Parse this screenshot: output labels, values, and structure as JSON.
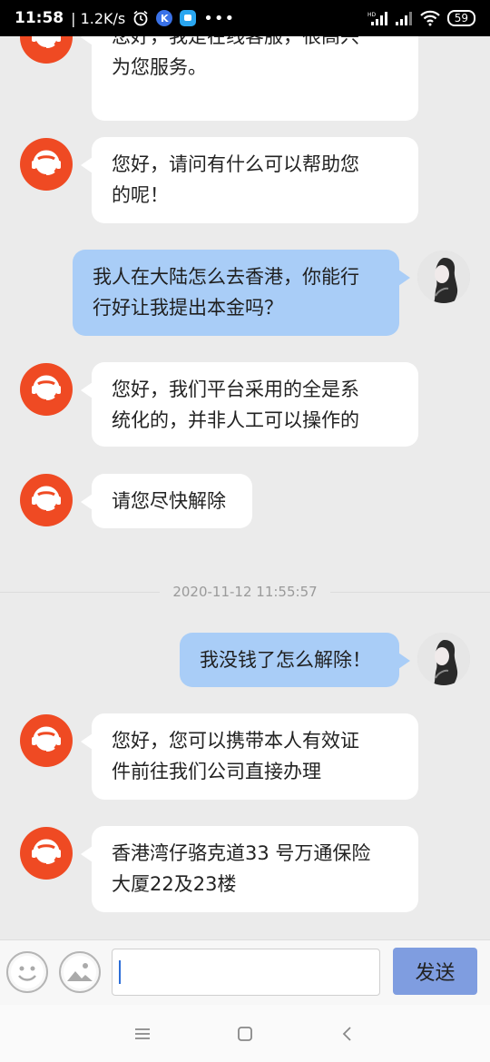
{
  "status_bar": {
    "time": "11:58",
    "speed": "| 1.2K/s",
    "battery": "59",
    "network_label": "HD"
  },
  "messages": [
    {
      "side": "in",
      "text": "您好，我是在线客服，很高兴为您服务。",
      "lines": [
        "您好，我是在线客服，很高兴",
        "为您服务。"
      ]
    },
    {
      "side": "in",
      "text": "您好，请问有什么可以帮助您的呢！",
      "lines": [
        "您好，请问有什么可以帮助您",
        "的呢！"
      ]
    },
    {
      "side": "out",
      "text": "我人在大陆怎么去香港，你能行行好让我提出本金吗？",
      "lines": [
        "我人在大陆怎么去香港，你能行",
        "行好让我提出本金吗？"
      ]
    },
    {
      "side": "in",
      "text": "您好，我们平台采用的全是系统化的，并非人工可以操作的",
      "lines": [
        "您好，我们平台采用的全是系",
        "统化的，并非人工可以操作的"
      ]
    },
    {
      "side": "in",
      "text": "请您尽快解除",
      "lines": [
        "请您尽快解除"
      ]
    },
    {
      "side": "out",
      "text": "我没钱了怎么解除！",
      "lines": [
        "我没钱了怎么解除！"
      ]
    },
    {
      "side": "in",
      "text": "您好，您可以携带本人有效证件前往我们公司直接办理",
      "lines": [
        "您好，您可以携带本人有效证",
        "件前往我们公司直接办理"
      ]
    },
    {
      "side": "in",
      "text": "香港湾仔骆克道33 号万通保险大厦22及23楼",
      "lines": [
        "香港湾仔骆克道33 号万通保险",
        "大厦22及23楼"
      ]
    }
  ],
  "timestamp": "2020-11-12 11:55:57",
  "input": {
    "value": "",
    "send_label": "发送"
  },
  "colors": {
    "agent_avatar": "#ef4a23",
    "outgoing_bubble": "#a9cdf7",
    "incoming_bubble": "#ffffff",
    "send_button": "#7f9de0",
    "background": "#ebebeb"
  }
}
